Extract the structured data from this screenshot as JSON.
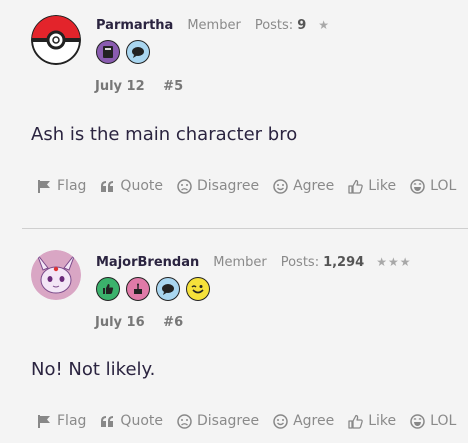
{
  "posts": [
    {
      "author": "Parmartha",
      "role": "Member",
      "posts_label": "Posts:",
      "posts_count": "9",
      "stars": "★",
      "date": "July 12",
      "number": "#5",
      "body": "Ash is the main character bro"
    },
    {
      "author": "MajorBrendan",
      "role": "Member",
      "posts_label": "Posts:",
      "posts_count": "1,294",
      "stars": "★★★",
      "date": "July 16",
      "number": "#6",
      "body": "No! Not likely."
    }
  ],
  "actions": {
    "flag": "Flag",
    "quote": "Quote",
    "disagree": "Disagree",
    "agree": "Agree",
    "like": "Like",
    "lol": "LOL"
  },
  "colors": {
    "background": "#f4f4f4",
    "text": "#2b2440",
    "muted": "#8a8a8a"
  }
}
